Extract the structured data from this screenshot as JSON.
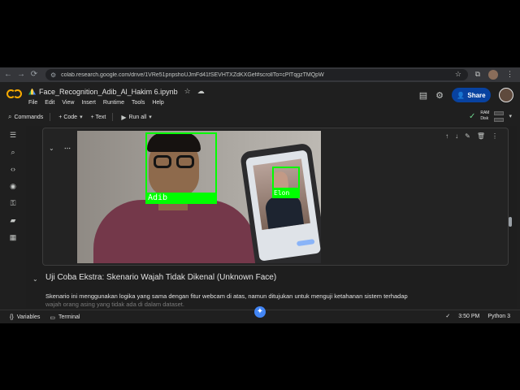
{
  "browser": {
    "url": "colab.research.google.com/drive/1VRe51pnpshoUJmFd41fSEVHTXZdKXGef#scrollTo=cPlTqgzTMQpW",
    "nav": {
      "back": "←",
      "forward": "→",
      "reload": "⟳"
    },
    "star": "☆",
    "icons": {
      "extensions": "⧉",
      "menu": "⋮"
    }
  },
  "colab": {
    "filename": "Face_Recognition_Adib_Al_Hakim 6.ipynb",
    "menu": [
      "File",
      "Edit",
      "View",
      "Insert",
      "Runtime",
      "Tools",
      "Help"
    ],
    "share_label": "Share",
    "share_icon": "👤"
  },
  "toolbar": {
    "commands": "Commands",
    "code": "+ Code",
    "code_caret": "▾",
    "text": "+ Text",
    "run_all": "Run all",
    "run_caret": "▾",
    "ram_label": "RAM",
    "disk_label": "Disk",
    "check": "✓",
    "caret": "▾"
  },
  "cell": {
    "faces": [
      {
        "label": "Adib"
      },
      {
        "label": "Elon"
      }
    ],
    "tools": {
      "up": "↑",
      "down": "↓",
      "edit": "✎",
      "delete": "🗑",
      "more": "⋮"
    }
  },
  "markdown": {
    "heading": "Uji Coba Ekstra: Skenario Wajah Tidak Dikenal (Unknown Face)",
    "paragraph": "Skenario ini menggunakan logika yang sama dengan fitur webcam di atas, namun ditujukan untuk menguji ketahanan sistem terhadap",
    "paragraph_cut": "wajah orang asing yang tidak ada di dalam dataset."
  },
  "statusbar": {
    "variables": "Variables",
    "terminal": "Terminal",
    "fab": "✦",
    "time": "3:50 PM",
    "runtime": "Python 3",
    "check": "✓"
  },
  "colors": {
    "accent": "#0842a0",
    "box": "#00ff00",
    "logo": "#f9ab00"
  }
}
